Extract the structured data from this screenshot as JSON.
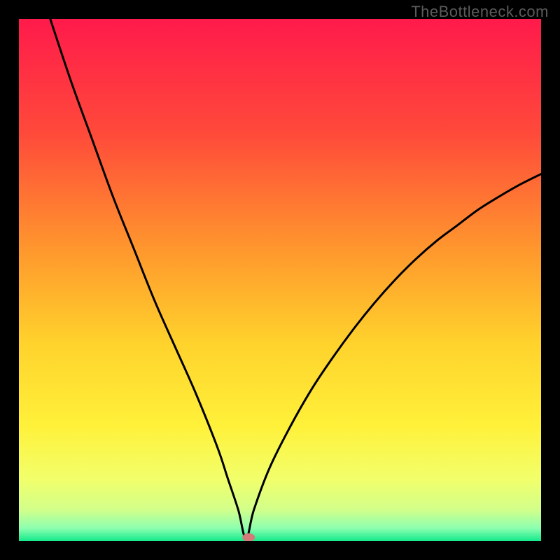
{
  "watermark": "TheBottleneck.com",
  "chart_data": {
    "type": "line",
    "title": "",
    "xlabel": "",
    "ylabel": "",
    "xlim": [
      0,
      100
    ],
    "ylim": [
      0,
      100
    ],
    "x": [
      6,
      10,
      14,
      18,
      22,
      26,
      30,
      34,
      38,
      40,
      42,
      43.5,
      45,
      48,
      52,
      56,
      60,
      64,
      68,
      72,
      76,
      80,
      84,
      88,
      92,
      96,
      100
    ],
    "values": [
      100,
      88,
      77,
      66,
      56,
      46,
      37,
      28,
      18,
      12,
      6,
      0.5,
      6,
      14,
      22,
      29,
      35,
      40.5,
      45.5,
      50,
      54,
      57.5,
      60.5,
      63.5,
      66,
      68.3,
      70.3
    ],
    "marker": {
      "x": 44,
      "y": 0.7
    },
    "gradient_stops": [
      {
        "offset": 0,
        "color": "#ff1a4b"
      },
      {
        "offset": 0.22,
        "color": "#ff4a3a"
      },
      {
        "offset": 0.45,
        "color": "#ff9a2d"
      },
      {
        "offset": 0.62,
        "color": "#ffd22c"
      },
      {
        "offset": 0.78,
        "color": "#fff13a"
      },
      {
        "offset": 0.88,
        "color": "#f2ff6a"
      },
      {
        "offset": 0.94,
        "color": "#d2ff8a"
      },
      {
        "offset": 0.975,
        "color": "#8dffb0"
      },
      {
        "offset": 1.0,
        "color": "#12e98b"
      }
    ]
  }
}
